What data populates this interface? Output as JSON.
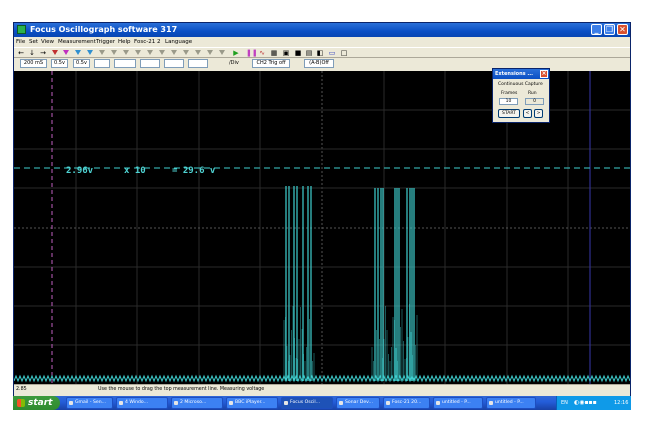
{
  "window": {
    "title": "Focus Oscillograph software 317",
    "buttons": [
      "_",
      "❐",
      "✕"
    ]
  },
  "menu": [
    "File",
    "Set",
    "View",
    "Measurement",
    "Trigger",
    "Help",
    "Fosc-21 2",
    "Language"
  ],
  "toolbar2": {
    "fields": [
      "200 mS",
      "0.5v",
      "0.5v",
      "",
      "",
      "",
      "",
      ""
    ],
    "div_label": "/Div",
    "trig_label": "CH2 Trig off",
    "math_label": "(A-B)Off"
  },
  "measurement": {
    "voltage": "2.96v",
    "multiplier": "x 10",
    "result": "= 29.6 v"
  },
  "status": {
    "left": "2.85",
    "message": "Use the mouse to drag the top measurement line. Measuring voltage"
  },
  "extensions": {
    "title": "Extensions ...",
    "continuous_capture": "Continuous Capture",
    "frames_label": "Frames",
    "run_label": "Run",
    "frames_value": "10",
    "run_value": "0",
    "start_button": "START",
    "prev": "<",
    "next": ">"
  },
  "taskbar": {
    "start": "start",
    "tasks": [
      "Gmail - Sen...",
      "4 Windo...",
      "2 Microso...",
      "BBC iPlayer...",
      "Focus Oscil...",
      "Sonar Dev...",
      "Fosc-21 20...",
      "untitled - P...",
      "untitled - P..."
    ],
    "tray_lang": "EN",
    "clock": "12:16"
  },
  "colors": {
    "trace": "#3fd0d0",
    "grid": "#2a2a2a",
    "marker": "#c060c0",
    "cursor": "#303090"
  }
}
